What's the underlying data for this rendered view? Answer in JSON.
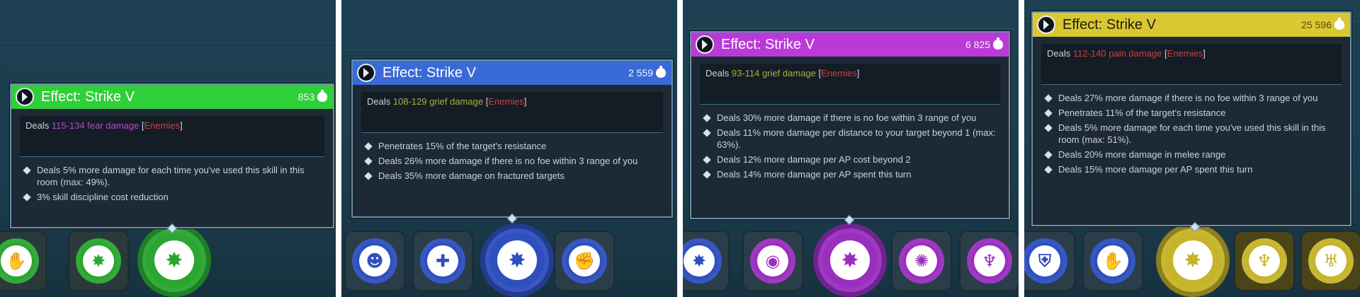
{
  "tooltips": [
    {
      "title": "Effect: Strike V",
      "price": "853",
      "header_color": "#2fcf39",
      "damage_prefix": "Deals",
      "damage": "115-134 fear damage",
      "damage_color": "#b04fc8",
      "target_open": "[",
      "target": "Enemies",
      "target_close": "]",
      "bullets": [
        "Deals 5% more damage for each time you've used this skill in this room (max: 49%).",
        "3% skill discipline cost reduction"
      ]
    },
    {
      "title": "Effect: Strike V",
      "price": "2 559",
      "header_color": "#3a6ad6",
      "damage_prefix": "Deals",
      "damage": "108-129 grief damage",
      "damage_color": "#a9b13a",
      "target_open": "[",
      "target": "Enemies",
      "target_close": "]",
      "bullets": [
        "Penetrates 15% of the target's resistance",
        "Deals 26% more damage if there is no foe within 3 range of you",
        "Deals 35% more damage on fractured targets"
      ]
    },
    {
      "title": "Effect: Strike V",
      "price": "6 825",
      "header_color": "#b93ad6",
      "damage_prefix": "Deals",
      "damage": "93-114 grief damage",
      "damage_color": "#a9b13a",
      "target_open": "[",
      "target": "Enemies",
      "target_close": "]",
      "bullets": [
        "Deals 30% more damage if there is no foe within 3 range of you",
        "Deals 11% more damage per distance to your target beyond 1 (max: 63%).",
        "Deals 12% more damage per AP cost beyond 2",
        "Deals 14% more damage per AP spent this turn"
      ]
    },
    {
      "title": "Effect: Strike V",
      "price": "25 596",
      "header_color": "#d9c832",
      "damage_prefix": "Deals",
      "damage": "112-140 pain damage",
      "damage_color": "#c9413d",
      "target_open": "[",
      "target": "Enemies",
      "target_close": "]",
      "bullets": [
        "Deals 27% more damage if there is no foe within 3 range of you",
        "Penetrates 11% of the target's resistance",
        "Deals 5% more damage for each time you've used this skill in this room (max: 51%).",
        "Deals 20% more damage in melee range",
        "Deals 15% more damage per AP spent this turn"
      ]
    }
  ],
  "icons": {
    "header_icon": "strike-effect-icon",
    "price_icon": "coin-bag-icon",
    "bullet_icon": "diamond-bullet-icon"
  },
  "orb_colors": {
    "green": "#2aa631",
    "blue": "#2f4fbf",
    "purple": "#9a2fbf",
    "yellow": "#c6b42a"
  }
}
